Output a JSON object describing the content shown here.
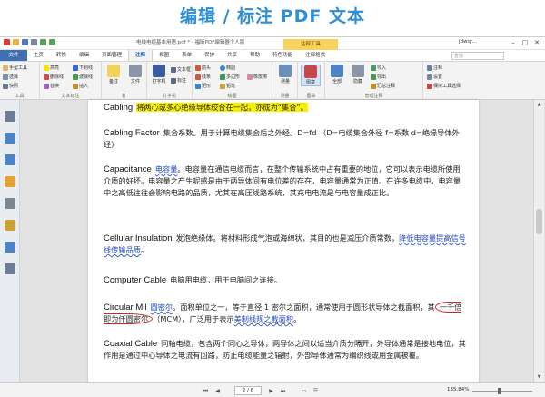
{
  "banner": {
    "title": "编辑 / 标注 PDF 文本"
  },
  "window": {
    "title": "电线电缆基本用语.pdf * - 福昕PDF编辑器个人版",
    "context_tab": "注释工具",
    "user": "jdwqr...",
    "minimize": "–",
    "maximize": "□",
    "close": "✕"
  },
  "menu": {
    "file": "文件",
    "tabs": [
      "主页",
      "转换",
      "编辑",
      "页面管理",
      "注释",
      "视图",
      "表单",
      "保护",
      "共享",
      "帮助",
      "特色功能",
      "注释格式"
    ],
    "active_index": 4,
    "search_placeholder": "查找"
  },
  "ribbon": {
    "group_labels": [
      "工具",
      "文本标注",
      "钉",
      "打字机",
      "绘图",
      "测量",
      "图章",
      "管理注释"
    ],
    "tools": [
      "手型工具",
      "选择",
      "快照"
    ],
    "text_markup": [
      "高亮",
      "下划线",
      "删除线",
      "波浪线",
      "替换",
      "插入"
    ],
    "note": "备注",
    "file": "文件",
    "typewriter": "打字机",
    "textbox": "文本框",
    "callout": "标注",
    "drawing": [
      "箭头",
      "线条",
      "矩形",
      "椭圆",
      "多边形",
      "铅笔",
      "橡皮擦"
    ],
    "measure": "测量",
    "stamp": "图章",
    "manage": [
      "导入",
      "导出",
      "汇总注释",
      "注释",
      "设置",
      "保持工具选择"
    ],
    "manage_big": [
      "全部",
      "隐藏"
    ]
  },
  "document": {
    "paragraphs": [
      {
        "term": "Cabling",
        "segments": [
          {
            "text": "将两心或多心绝缘导体绞合在一起，亦成为“集合”。",
            "style": "hl-yellow"
          }
        ]
      },
      {
        "term": "Cabling  Factor",
        "segments": [
          {
            "text": "集合系数。用于计算电缆集合后之外经。D=fd  （D=电缆集合外径   f=系数   d=绝缘导体外经）",
            "style": ""
          }
        ]
      },
      {
        "term": "Capacitance",
        "segments": [
          {
            "text": "电容量",
            "style": "ul-blue"
          },
          {
            "text": "。电容量在通信电缆而言，在整个传输系统中占有重要的地位，它可以表示电缆所使用介质的好坏。电容量之产生呢感是由于两导体间有电位差的存在，电容量通常为正值。在许多电缆中，电容量中之高低往往会影响电路的品质，尤其在高压线路系统，其充电电流是与电容量成正比。",
            "style": ""
          }
        ]
      },
      {
        "term": "Cellular  Insulation",
        "segments": [
          {
            "text": "发泡绝缘体。将材料形成气泡或海绵状，其目的也是减压介质常数，",
            "style": ""
          },
          {
            "text": "降低电容量提高信号线传输品质",
            "style": "ul-blue"
          },
          {
            "text": "。",
            "style": ""
          }
        ]
      },
      {
        "term": "Computer  Cable",
        "segments": [
          {
            "text": "电脑用电缆，用于电脑间之连接。",
            "style": ""
          }
        ]
      },
      {
        "term": "Circular  Mil",
        "segments": [
          {
            "text": "圆密尔",
            "style": "ul-blue"
          },
          {
            "text": "。面积单位之一，等于直径 1 密尔之面积，通常使用于圆形状导体之截面积，其",
            "style": ""
          },
          {
            "text": "一千倍即为仟圆密尔",
            "style": "circle-ann"
          },
          {
            "text": "（MCM），广泛用于表示",
            "style": ""
          },
          {
            "text": "美制线规之截面积",
            "style": "ul-blue"
          },
          {
            "text": "。",
            "style": ""
          }
        ]
      },
      {
        "term": "Coaxial  Cable",
        "segments": [
          {
            "text": "同轴电缆，包含两个同心之导体，两导体之间以适当介质分隔开，外导体通常是接地电位，其作用是通过中心导体之电流有回路，防止电缆能量之辐射，外部导体通常为编织线或用金属被覆。",
            "style": ""
          }
        ]
      }
    ]
  },
  "status": {
    "page_display": "2 / 6",
    "zoom": "135.84%",
    "zoom_level": 0.45
  },
  "colors": {
    "banner_blue": "#2e8fd6",
    "file_tab": "#3f6fb4",
    "context_tab": "#f7d35c",
    "highlight": "#f6f000",
    "underline": "#3a64d8",
    "circle": "#d92020"
  }
}
